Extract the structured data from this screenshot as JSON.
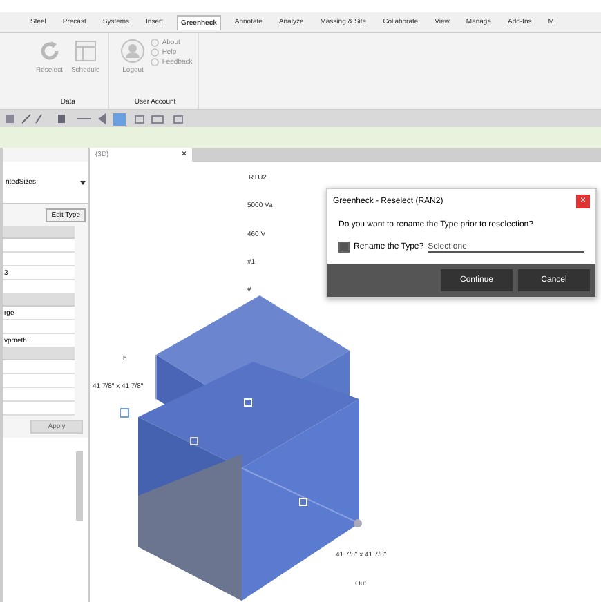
{
  "ribbon_tabs": [
    {
      "label": "Steel",
      "selected": false
    },
    {
      "label": "Precast",
      "selected": false
    },
    {
      "label": "Systems",
      "selected": false
    },
    {
      "label": "Insert",
      "selected": false
    },
    {
      "label": "Greenheck",
      "selected": true
    },
    {
      "label": "Annotate",
      "selected": false
    },
    {
      "label": "Analyze",
      "selected": false
    },
    {
      "label": "Massing & Site",
      "selected": false
    },
    {
      "label": "Collaborate",
      "selected": false
    },
    {
      "label": "View",
      "selected": false
    },
    {
      "label": "Manage",
      "selected": false
    },
    {
      "label": "Add-Ins",
      "selected": false
    },
    {
      "label": "M",
      "selected": false
    }
  ],
  "ribbon_groups": [
    {
      "label": "Data",
      "large_buttons": [
        {
          "label": "Reselect",
          "kind": "reselect",
          "disabled": true
        },
        {
          "label": "Schedule",
          "kind": "schedule",
          "disabled": true
        }
      ]
    },
    {
      "label": "User Account",
      "large_buttons": [
        {
          "label": "Logout",
          "kind": "user",
          "disabled": true
        }
      ],
      "small_buttons": [
        {
          "label": "About",
          "disabled": true
        },
        {
          "label": "Help",
          "disabled": true
        },
        {
          "label": "Feedback",
          "disabled": true
        }
      ]
    }
  ],
  "properties": {
    "type_selector": "ntedSizes",
    "edit_type": "Edit Type",
    "rows": [
      {
        "kind": "section"
      },
      {
        "kind": "row",
        "value": ""
      },
      {
        "kind": "row",
        "value": ""
      },
      {
        "kind": "row",
        "value": "3"
      },
      {
        "kind": "row",
        "value": ""
      },
      {
        "kind": "section"
      },
      {
        "kind": "row",
        "value": "rge"
      },
      {
        "kind": "row",
        "value": ""
      },
      {
        "kind": "row",
        "value": "vpmeth..."
      },
      {
        "kind": "section"
      },
      {
        "kind": "row",
        "value": ""
      },
      {
        "kind": "row",
        "value": ""
      },
      {
        "kind": "row",
        "value": ""
      },
      {
        "kind": "row",
        "value": ""
      }
    ],
    "apply": "Apply"
  },
  "view_tab": {
    "label": "{3D}",
    "close": "×"
  },
  "canvas_labels": [
    "RTU2",
    "5000 Va",
    "460 V",
    "#1",
    "#",
    "b",
    "41 7/8\" x 41 7/8\"",
    "41 7/8\" x 41 7/8\"",
    "Out"
  ],
  "dialog": {
    "title": "Greenheck - Reselect (RAN2)",
    "close": "×",
    "question": "Do you want to rename the Type prior to reselection?",
    "checkbox": {
      "label": "Rename the Type?",
      "checked": true
    },
    "field": {
      "placeholder": "Select one"
    },
    "buttons": [
      {
        "label": "Continue"
      },
      {
        "label": "Cancel"
      }
    ]
  }
}
